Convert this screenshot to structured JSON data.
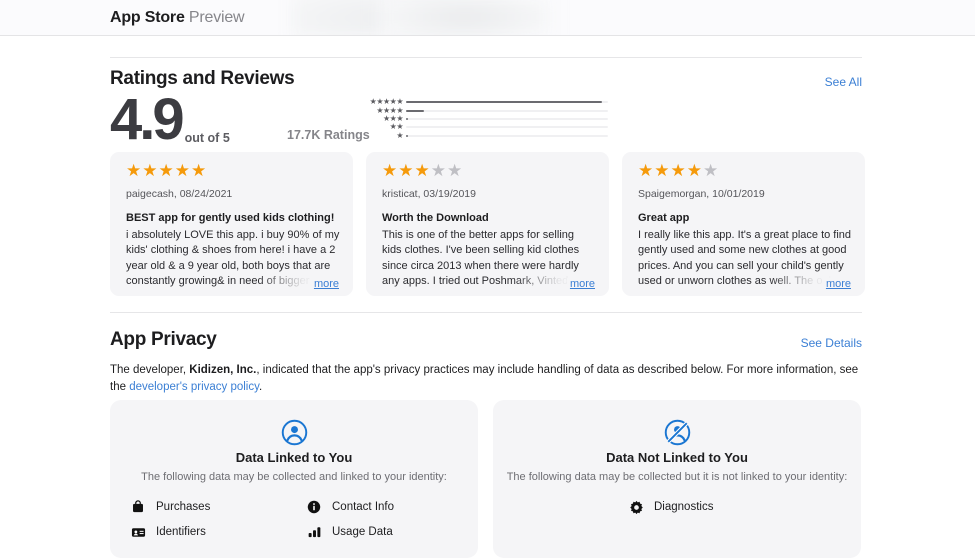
{
  "topbar": {
    "brand": "App Store",
    "suffix": "Preview"
  },
  "ratings": {
    "heading": "Ratings and Reviews",
    "see_all": "See All",
    "score": "4.9",
    "out_of": "out of 5",
    "count": "17.7K Ratings",
    "histogram": {
      "rows": [
        {
          "stars": "★★★★★",
          "pct": 97
        },
        {
          "stars": "★★★★",
          "pct": 9
        },
        {
          "stars": "★★★",
          "pct": 1
        },
        {
          "stars": "★★",
          "pct": 0
        },
        {
          "stars": "★",
          "pct": 1
        }
      ]
    },
    "reviews": [
      {
        "rating": 5,
        "stars_on": "★★★★★",
        "stars_off": "",
        "author_date": "paigecash, 08/24/2021",
        "title": "BEST app for gently used kids clothing!",
        "body": "i absolutely LOVE this app. i buy 90% of my kids' clothing & shoes from here! i have a 2 year old & a 9 year old, both boys that are constantly growing& in need of bigger clothes",
        "more": "more"
      },
      {
        "rating": 3,
        "stars_on": "★★★",
        "stars_off": "★★",
        "author_date": "kristicat, 03/19/2019",
        "title": "Worth the Download",
        "body": "This is one of the better apps for selling kids clothes. I've been selling kid clothes since circa 2013 when there were hardly any apps. I tried out Poshmark, Vinted, Totspot, eBay",
        "more": "more"
      },
      {
        "rating": 4,
        "stars_on": "★★★★",
        "stars_off": "★",
        "author_date": "Spaigemorgan, 10/01/2019",
        "title": "Great app",
        "body": "I really like this app. It's a great place to find gently used and some new clothes at good prices. And you can sell your child's gently used or unworn clothes as well. The only",
        "more": "more"
      }
    ]
  },
  "privacy": {
    "heading": "App Privacy",
    "see_details": "See Details",
    "desc_part1": "The developer, ",
    "developer": "Kidizen, Inc.",
    "desc_part2": ", indicated that the app's privacy practices may include handling of data as described below. For more information, see the ",
    "policy_link": "developer's privacy policy",
    "desc_part3": ".",
    "cards": [
      {
        "icon": "person-circle-icon",
        "title": "Data Linked to You",
        "subtitle": "The following data may be collected and linked to your identity:",
        "items": [
          {
            "icon": "bag-icon",
            "label": "Purchases"
          },
          {
            "icon": "contact-card-icon",
            "label": "Identifiers"
          },
          {
            "icon": "info-circle-icon",
            "label": "Contact Info"
          },
          {
            "icon": "bar-chart-icon",
            "label": "Usage Data"
          }
        ]
      },
      {
        "icon": "person-circle-slash-icon",
        "title": "Data Not Linked to You",
        "subtitle": "The following data may be collected but it is not linked to your identity:",
        "items": [
          {
            "icon": "gear-icon",
            "label": "Diagnostics"
          }
        ]
      }
    ]
  },
  "colors": {
    "link": "#3b7fd4",
    "star": "#f59a0b",
    "star_off": "#bfbfc4",
    "card_bg": "#f5f5f7",
    "privacy_icon": "#1a76d2"
  }
}
